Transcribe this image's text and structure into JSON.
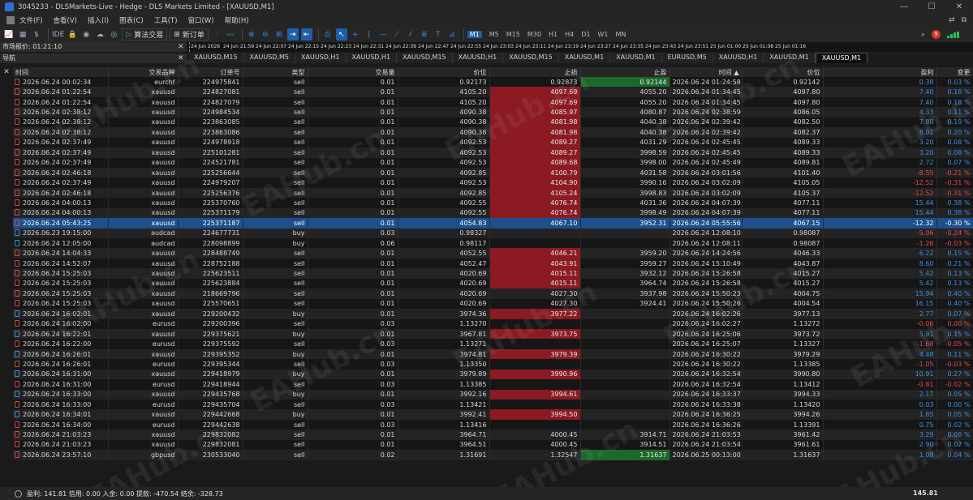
{
  "window": {
    "title": "3045233 - DLSMarkets-Live - Hedge - DLS Markets Limited - [XAUUSD,M1]",
    "buttons": [
      "—",
      "☐",
      "✕"
    ]
  },
  "menu": {
    "items": [
      "文件(F)",
      "查看(V)",
      "插入(I)",
      "图表(C)",
      "工具(T)",
      "窗口(W)",
      "帮助(H)"
    ]
  },
  "toolbar": {
    "algo_label": "算法交易",
    "new_order_label": "新订单",
    "ide_label": "IDE",
    "timeframes": [
      "M1",
      "M5",
      "M15",
      "M30",
      "H1",
      "H4",
      "D1",
      "W1",
      "MN"
    ],
    "active_timeframe": "M1",
    "notification_count": "9"
  },
  "market_watch": {
    "title": "市场报价: 01:21:10"
  },
  "navigator": {
    "title": "导航"
  },
  "timescale": [
    "24 Jun 2026",
    "24 Jun 21:59",
    "24 Jun 22:07",
    "24 Jun 22:15",
    "24 Jun 22:23",
    "24 Jun 22:31",
    "24 Jun 22:39",
    "24 Jun 22:47",
    "24 Jun 22:55",
    "24 Jun 23:03",
    "24 Jun 23:11",
    "24 Jun 23:19",
    "24 Jun 23:27",
    "24 Jun 23:35",
    "24 Jun 23:43",
    "24 Jun 23:51",
    "25 Jun 01:00",
    "25 Jun 01:08",
    "25 Jun 01:16"
  ],
  "chart_tabs": [
    "XAUUSD,M15",
    "XAUUSD,M5",
    "XAUUSD,H1",
    "XAUUSD,H1",
    "XAUUSD,M15",
    "XAUUSD,H1",
    "XAUUSD,M15",
    "XAUUSD,M1",
    "XAUUSD,M1",
    "EURUSD,M5",
    "XAUUSD,H1",
    "XAUUSD,M1",
    "XAUUSD,M1"
  ],
  "active_chart_tab": 12,
  "table": {
    "headers": [
      "时间",
      "交易品种",
      "订单号",
      "类型",
      "交易量",
      "价位",
      "止损",
      "止盈",
      "时间",
      "价位",
      "盈利",
      "变更"
    ],
    "sort_indicator": "▲",
    "rows": [
      {
        "time": "2026.06.24 00:02:34",
        "symbol": "eurchf",
        "ticket": "224975841",
        "type": "sell",
        "volume": "0.01",
        "price": "0.92173",
        "sl": "0.92873",
        "tp": "0.92144",
        "ctime": "2026.06.24 01:24:58",
        "cprice": "0.92142",
        "profit": "0.38",
        "change": "0.03 %",
        "sl_hit": false,
        "tp_hit": true,
        "neg": false
      },
      {
        "time": "2026.06.24 01:22:54",
        "symbol": "xauusd",
        "ticket": "224827081",
        "type": "sell",
        "volume": "0.01",
        "price": "4105.20",
        "sl": "4097.69",
        "tp": "4055.20",
        "ctime": "2026.06.24 01:34:45",
        "cprice": "4097.80",
        "profit": "7.40",
        "change": "0.18 %",
        "sl_hit": true,
        "tp_hit": false,
        "neg": false
      },
      {
        "time": "2026.06.24 01:22:54",
        "symbol": "xauusd",
        "ticket": "224827079",
        "type": "sell",
        "volume": "0.01",
        "price": "4105.20",
        "sl": "4097.69",
        "tp": "4055.20",
        "ctime": "2026.06.24 01:34:45",
        "cprice": "4097.80",
        "profit": "7.40",
        "change": "0.18 %",
        "sl_hit": true,
        "tp_hit": false,
        "neg": false
      },
      {
        "time": "2026.06.24 02:38:12",
        "symbol": "xauusd",
        "ticket": "224984534",
        "type": "sell",
        "volume": "0.01",
        "price": "4090.38",
        "sl": "4085.97",
        "tp": "4080.87",
        "ctime": "2026.06.24 02:38:59",
        "cprice": "4086.05",
        "profit": "4.33",
        "change": "0.11 %",
        "sl_hit": true,
        "tp_hit": false,
        "neg": false
      },
      {
        "time": "2026.06.24 02:38:12",
        "symbol": "xauusd",
        "ticket": "223863085",
        "type": "sell",
        "volume": "0.01",
        "price": "4090.38",
        "sl": "4081.98",
        "tp": "4040.38",
        "ctime": "2026.06.24 02:39:42",
        "cprice": "4082.50",
        "profit": "7.88",
        "change": "0.19 %",
        "sl_hit": true,
        "tp_hit": false,
        "neg": false
      },
      {
        "time": "2026.06.24 02:38:12",
        "symbol": "xauusd",
        "ticket": "223863086",
        "type": "sell",
        "volume": "0.01",
        "price": "4090.38",
        "sl": "4081.98",
        "tp": "4040.38",
        "ctime": "2026.06.24 02:39:42",
        "cprice": "4082.37",
        "profit": "8.01",
        "change": "0.20 %",
        "sl_hit": true,
        "tp_hit": false,
        "neg": false
      },
      {
        "time": "2026.06.24 02:37:49",
        "symbol": "xauusd",
        "ticket": "224978918",
        "type": "sell",
        "volume": "0.01",
        "price": "4092.53",
        "sl": "4089.27",
        "tp": "4031.29",
        "ctime": "2026.06.24 02:45:45",
        "cprice": "4089.33",
        "profit": "3.20",
        "change": "0.08 %",
        "sl_hit": true,
        "tp_hit": false,
        "neg": false
      },
      {
        "time": "2026.06.24 02:37:49",
        "symbol": "xauusd",
        "ticket": "225101281",
        "type": "sell",
        "volume": "0.01",
        "price": "4092.53",
        "sl": "4089.27",
        "tp": "3998.59",
        "ctime": "2026.06.24 02:45:45",
        "cprice": "4089.33",
        "profit": "3.20",
        "change": "0.08 %",
        "sl_hit": true,
        "tp_hit": false,
        "neg": false
      },
      {
        "time": "2026.06.24 02:37:49",
        "symbol": "xauusd",
        "ticket": "224521781",
        "type": "sell",
        "volume": "0.01",
        "price": "4092.53",
        "sl": "4089.68",
        "tp": "3998.00",
        "ctime": "2026.06.24 02:45:49",
        "cprice": "4089.81",
        "profit": "2.72",
        "change": "0.07 %",
        "sl_hit": true,
        "tp_hit": false,
        "neg": false
      },
      {
        "time": "2026.06.24 02:46:18",
        "symbol": "xauusd",
        "ticket": "225256644",
        "type": "sell",
        "volume": "0.01",
        "price": "4092.85",
        "sl": "4100.79",
        "tp": "4031.58",
        "ctime": "2026.06.24 03:01:56",
        "cprice": "4101.40",
        "profit": "-8.55",
        "change": "-0.21 %",
        "sl_hit": true,
        "tp_hit": false,
        "neg": true
      },
      {
        "time": "2026.06.24 02:37:49",
        "symbol": "xauusd",
        "ticket": "224979207",
        "type": "sell",
        "volume": "0.01",
        "price": "4092.53",
        "sl": "4104.90",
        "tp": "3990.16",
        "ctime": "2026.06.24 03:02:09",
        "cprice": "4105.05",
        "profit": "-12.52",
        "change": "-0.31 %",
        "sl_hit": true,
        "tp_hit": false,
        "neg": true
      },
      {
        "time": "2026.06.24 02:46:18",
        "symbol": "xauusd",
        "ticket": "225256376",
        "type": "sell",
        "volume": "0.01",
        "price": "4092.85",
        "sl": "4105.24",
        "tp": "3998.83",
        "ctime": "2026.06.24 03:02:09",
        "cprice": "4105.37",
        "profit": "-12.52",
        "change": "-0.31 %",
        "sl_hit": true,
        "tp_hit": false,
        "neg": true
      },
      {
        "time": "2026.06.24 04:00:13",
        "symbol": "xauusd",
        "ticket": "225370760",
        "type": "sell",
        "volume": "0.01",
        "price": "4092.55",
        "sl": "4076.74",
        "tp": "4031.36",
        "ctime": "2026.06.24 04:07:39",
        "cprice": "4077.11",
        "profit": "15.44",
        "change": "0.38 %",
        "sl_hit": true,
        "tp_hit": false,
        "neg": false
      },
      {
        "time": "2026.06.24 04:00:13",
        "symbol": "xauusd",
        "ticket": "225371179",
        "type": "sell",
        "volume": "0.01",
        "price": "4092.55",
        "sl": "4076.74",
        "tp": "3998.49",
        "ctime": "2026.06.24 04:07:39",
        "cprice": "4077.11",
        "profit": "15.44",
        "change": "0.38 %",
        "sl_hit": true,
        "tp_hit": false,
        "neg": false
      },
      {
        "time": "2026.06.24 05:43:25",
        "symbol": "xauusd",
        "ticket": "225371187",
        "type": "sell",
        "volume": "0.01",
        "price": "4054.83",
        "sl": "4067.10",
        "tp": "3952.31",
        "ctime": "2026.06.24 05:55:56",
        "cprice": "4067.15",
        "profit": "-12.32",
        "change": "-0.30 %",
        "sl_hit": false,
        "tp_hit": false,
        "neg": true,
        "selected": true
      },
      {
        "time": "2026.06.23 19:15:00",
        "symbol": "audcad",
        "ticket": "224677731",
        "type": "buy",
        "volume": "0.03",
        "price": "0.98327",
        "sl": "",
        "tp": "",
        "ctime": "2026.06.24 12:08:10",
        "cprice": "0.98087",
        "profit": "-5.06",
        "change": "-0.24 %",
        "sl_hit": false,
        "tp_hit": false,
        "neg": true
      },
      {
        "time": "2026.06.24 12:05:00",
        "symbol": "audcad",
        "ticket": "228098899",
        "type": "buy",
        "volume": "0.06",
        "price": "0.98117",
        "sl": "",
        "tp": "",
        "ctime": "2026.06.24 12:08:11",
        "cprice": "0.98087",
        "profit": "-1.26",
        "change": "-0.03 %",
        "sl_hit": false,
        "tp_hit": false,
        "neg": true
      },
      {
        "time": "2026.06.24 14:04:33",
        "symbol": "xauusd",
        "ticket": "228488749",
        "type": "sell",
        "volume": "0.01",
        "price": "4052.55",
        "sl": "4046.21",
        "tp": "3959.20",
        "ctime": "2026.06.24 14:24:56",
        "cprice": "4046.33",
        "profit": "6.22",
        "change": "0.15 %",
        "sl_hit": true,
        "tp_hit": false,
        "neg": false
      },
      {
        "time": "2026.06.24 14:52:07",
        "symbol": "xauusd",
        "ticket": "228752188",
        "type": "sell",
        "volume": "0.01",
        "price": "4052.47",
        "sl": "4043.91",
        "tp": "3959.27",
        "ctime": "2026.06.24 15:10:49",
        "cprice": "4043.87",
        "profit": "8.60",
        "change": "0.21 %",
        "sl_hit": true,
        "tp_hit": false,
        "neg": false
      },
      {
        "time": "2026.06.24 15:25:03",
        "symbol": "xauusd",
        "ticket": "225623511",
        "type": "sell",
        "volume": "0.01",
        "price": "4020.69",
        "sl": "4015.11",
        "tp": "3932.12",
        "ctime": "2026.06.24 15:26:58",
        "cprice": "4015.27",
        "profit": "5.42",
        "change": "0.13 %",
        "sl_hit": true,
        "tp_hit": false,
        "neg": false
      },
      {
        "time": "2026.06.24 15:25:03",
        "symbol": "xauusd",
        "ticket": "225623884",
        "type": "sell",
        "volume": "0.01",
        "price": "4020.69",
        "sl": "4015.11",
        "tp": "3964.74",
        "ctime": "2026.06.24 15:26:58",
        "cprice": "4015.27",
        "profit": "5.42",
        "change": "0.13 %",
        "sl_hit": true,
        "tp_hit": false,
        "neg": false
      },
      {
        "time": "2026.06.24 15:25:03",
        "symbol": "xauusd",
        "ticket": "218669796",
        "type": "sell",
        "volume": "0.01",
        "price": "4020.69",
        "sl": "4027.30",
        "tp": "3937.98",
        "ctime": "2026.06.24 15:50:23",
        "cprice": "4004.75",
        "profit": "15.94",
        "change": "0.40 %",
        "sl_hit": false,
        "tp_hit": false,
        "neg": false
      },
      {
        "time": "2026.06.24 15:25:03",
        "symbol": "xauusd",
        "ticket": "225570651",
        "type": "sell",
        "volume": "0.01",
        "price": "4020.69",
        "sl": "4027.30",
        "tp": "3924.41",
        "ctime": "2026.06.24 15:50:26",
        "cprice": "4004.54",
        "profit": "16.15",
        "change": "0.40 %",
        "sl_hit": false,
        "tp_hit": false,
        "neg": false
      },
      {
        "time": "2026.06.24 16:02:01",
        "symbol": "xauusd",
        "ticket": "229200432",
        "type": "buy",
        "volume": "0.01",
        "price": "3974.36",
        "sl": "3977.22",
        "tp": "",
        "ctime": "2026.06.24 16:02:26",
        "cprice": "3977.13",
        "profit": "2.77",
        "change": "0.07 %",
        "sl_hit": true,
        "tp_hit": false,
        "neg": false
      },
      {
        "time": "2026.06.24 16:02:00",
        "symbol": "eurusd",
        "ticket": "229200396",
        "type": "sell",
        "volume": "0.03",
        "price": "1.13270",
        "sl": "",
        "tp": "",
        "ctime": "2026.06.24 16:02:27",
        "cprice": "1.13272",
        "profit": "-0.06",
        "change": "0.00 %",
        "sl_hit": false,
        "tp_hit": false,
        "neg": true
      },
      {
        "time": "2026.06.24 16:22:01",
        "symbol": "xauusd",
        "ticket": "229375621",
        "type": "buy",
        "volume": "0.01",
        "price": "3967.81",
        "sl": "3973.75",
        "tp": "",
        "ctime": "2026.06.24 16:25:06",
        "cprice": "3973.72",
        "profit": "5.91",
        "change": "0.15 %",
        "sl_hit": true,
        "tp_hit": false,
        "neg": false
      },
      {
        "time": "2026.06.24 16:22:00",
        "symbol": "eurusd",
        "ticket": "229375592",
        "type": "sell",
        "volume": "0.03",
        "price": "1.13271",
        "sl": "",
        "tp": "",
        "ctime": "2026.06.24 16:25:07",
        "cprice": "1.13327",
        "profit": "-1.68",
        "change": "-0.05 %",
        "sl_hit": false,
        "tp_hit": false,
        "neg": true
      },
      {
        "time": "2026.06.24 16:26:01",
        "symbol": "xauusd",
        "ticket": "229395352",
        "type": "buy",
        "volume": "0.01",
        "price": "3974.81",
        "sl": "3979.39",
        "tp": "",
        "ctime": "2026.06.24 16:30:22",
        "cprice": "3979.29",
        "profit": "4.48",
        "change": "0.11 %",
        "sl_hit": true,
        "tp_hit": false,
        "neg": false
      },
      {
        "time": "2026.06.24 16:26:01",
        "symbol": "eurusd",
        "ticket": "229395344",
        "type": "sell",
        "volume": "0.03",
        "price": "1.13350",
        "sl": "",
        "tp": "",
        "ctime": "2026.06.24 16:30:22",
        "cprice": "1.13385",
        "profit": "-1.05",
        "change": "-0.03 %",
        "sl_hit": false,
        "tp_hit": false,
        "neg": true
      },
      {
        "time": "2026.06.24 16:31:00",
        "symbol": "xauusd",
        "ticket": "229418979",
        "type": "buy",
        "volume": "0.01",
        "price": "3979.89",
        "sl": "3990.96",
        "tp": "",
        "ctime": "2026.06.24 16:32:54",
        "cprice": "3990.80",
        "profit": "10.91",
        "change": "0.27 %",
        "sl_hit": true,
        "tp_hit": false,
        "neg": false
      },
      {
        "time": "2026.06.24 16:31:00",
        "symbol": "eurusd",
        "ticket": "229418944",
        "type": "sell",
        "volume": "0.03",
        "price": "1.13385",
        "sl": "",
        "tp": "",
        "ctime": "2026.06.24 16:32:54",
        "cprice": "1.13412",
        "profit": "-0.81",
        "change": "-0.02 %",
        "sl_hit": false,
        "tp_hit": false,
        "neg": true
      },
      {
        "time": "2026.06.24 16:33:00",
        "symbol": "xauusd",
        "ticket": "229435768",
        "type": "buy",
        "volume": "0.01",
        "price": "3992.16",
        "sl": "3994.61",
        "tp": "",
        "ctime": "2026.06.24 16:33:37",
        "cprice": "3994.33",
        "profit": "2.17",
        "change": "0.05 %",
        "sl_hit": true,
        "tp_hit": false,
        "neg": false
      },
      {
        "time": "2026.06.24 16:33:00",
        "symbol": "eurusd",
        "ticket": "229435704",
        "type": "sell",
        "volume": "0.03",
        "price": "1.13421",
        "sl": "",
        "tp": "",
        "ctime": "2026.06.24 16:33:38",
        "cprice": "1.13420",
        "profit": "0.03",
        "change": "0.00 %",
        "sl_hit": false,
        "tp_hit": false,
        "neg": false
      },
      {
        "time": "2026.06.24 16:34:01",
        "symbol": "xauusd",
        "ticket": "229442668",
        "type": "buy",
        "volume": "0.01",
        "price": "3992.41",
        "sl": "3994.50",
        "tp": "",
        "ctime": "2026.06.24 16:36:25",
        "cprice": "3994.26",
        "profit": "1.85",
        "change": "0.05 %",
        "sl_hit": true,
        "tp_hit": false,
        "neg": false
      },
      {
        "time": "2026.06.24 16:34:00",
        "symbol": "eurusd",
        "ticket": "229442638",
        "type": "sell",
        "volume": "0.03",
        "price": "1.13416",
        "sl": "",
        "tp": "",
        "ctime": "2026.06.24 16:36:26",
        "cprice": "1.13391",
        "profit": "0.75",
        "change": "0.02 %",
        "sl_hit": false,
        "tp_hit": false,
        "neg": false
      },
      {
        "time": "2026.06.24 21:03:23",
        "symbol": "xauusd",
        "ticket": "229832082",
        "type": "sell",
        "volume": "0.01",
        "price": "3964.71",
        "sl": "4000.45",
        "tp": "3914.71",
        "ctime": "2026.06.24 21:03:53",
        "cprice": "3961.42",
        "profit": "3.29",
        "change": "0.08 %",
        "sl_hit": false,
        "tp_hit": false,
        "neg": false
      },
      {
        "time": "2026.06.24 21:03:23",
        "symbol": "xauusd",
        "ticket": "229832081",
        "type": "sell",
        "volume": "0.01",
        "price": "3964.51",
        "sl": "4000.45",
        "tp": "3914.51",
        "ctime": "2026.06.24 21:03:54",
        "cprice": "3961.61",
        "profit": "2.90",
        "change": "0.07 %",
        "sl_hit": false,
        "tp_hit": false,
        "neg": false
      },
      {
        "time": "2026.06.24 23:57:10",
        "symbol": "gbpusd",
        "ticket": "230533040",
        "type": "sell",
        "volume": "0.02",
        "price": "1.31691",
        "sl": "1.32547",
        "tp": "1.31637",
        "ctime": "2026.06.25 00:13:00",
        "cprice": "1.31637",
        "profit": "1.08",
        "change": "0.04 %",
        "sl_hit": false,
        "tp_hit": true,
        "neg": false
      }
    ]
  },
  "status": {
    "summary": "盈利: 141.81  信用: 0.00  入金: 0.00  提款: -470.54  结余: -328.73",
    "total": "145.81"
  },
  "watermark": "EAHub.cn"
}
